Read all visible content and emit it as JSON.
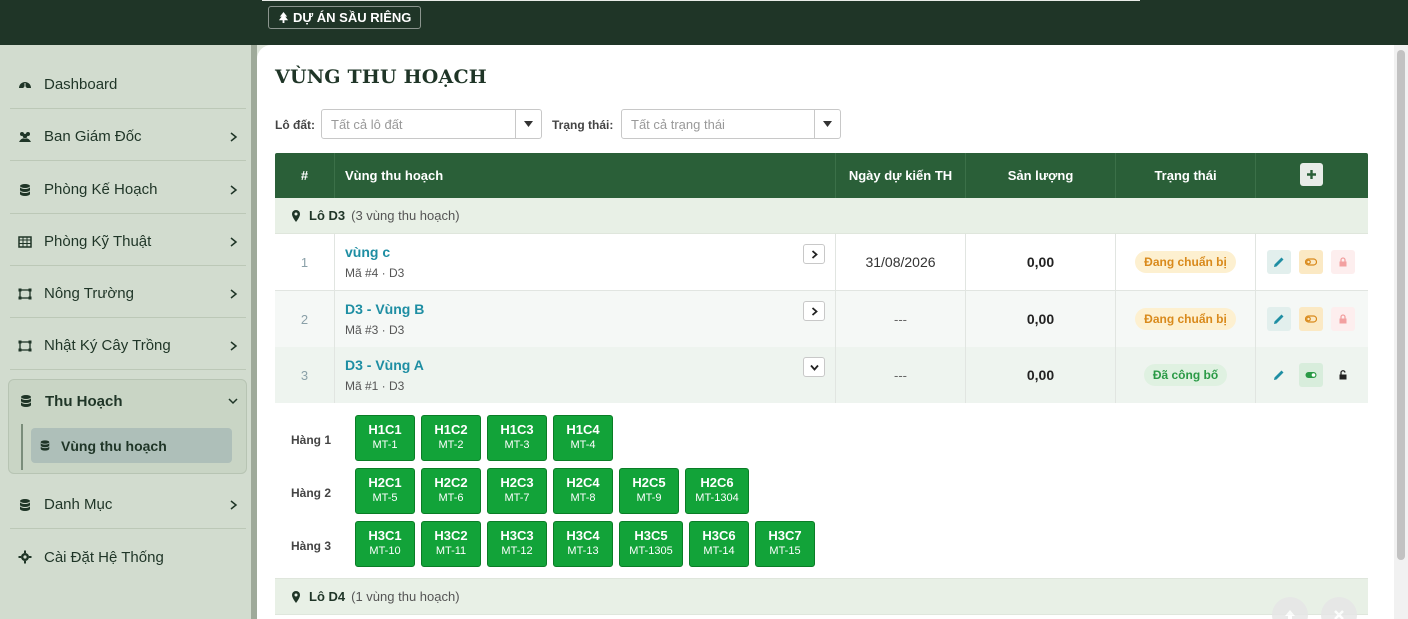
{
  "header": {
    "project_label": "DỰ ÁN SẦU RIÊNG"
  },
  "sidebar": {
    "items": [
      {
        "label": "Dashboard",
        "icon": "dashboard-icon"
      },
      {
        "label": "Ban Giám Đốc",
        "icon": "users-icon"
      },
      {
        "label": "Phòng Kế Hoạch",
        "icon": "database-icon"
      },
      {
        "label": "Phòng Kỹ Thuật",
        "icon": "table-icon"
      },
      {
        "label": "Nông Trường",
        "icon": "farm-icon"
      },
      {
        "label": "Nhật Ký Cây Trồng",
        "icon": "farm-icon"
      }
    ],
    "active_group": {
      "label": "Thu Hoạch",
      "sub_item": "Vùng thu hoạch"
    },
    "bottom_items": [
      {
        "label": "Danh Mục",
        "icon": "database-icon"
      },
      {
        "label": "Cài Đặt Hệ Thống",
        "icon": "gear-icon"
      }
    ]
  },
  "page": {
    "title": "VÙNG THU HOẠCH"
  },
  "filters": {
    "lot_label": "Lô đất:",
    "lot_placeholder": "Tất cả lô đất",
    "status_label": "Trạng thái:",
    "status_placeholder": "Tất cả trạng thái"
  },
  "table": {
    "headers": {
      "num": "#",
      "zone": "Vùng thu hoạch",
      "date": "Ngày dự kiến TH",
      "qty": "Sản lượng",
      "status": "Trạng thái"
    },
    "group1": {
      "name": "Lô D3",
      "count": "(3 vùng thu hoạch)"
    },
    "rows": [
      {
        "num": "1",
        "name": "vùng c",
        "sub": "Mã #4 · D3",
        "date": "31/08/2026",
        "qty": "0,00",
        "status": "Đang chuẩn bị"
      },
      {
        "num": "2",
        "name": "D3 - Vùng B",
        "sub": "Mã #3 · D3",
        "date": "---",
        "qty": "0,00",
        "status": "Đang chuẩn bị"
      },
      {
        "num": "3",
        "name": "D3 - Vùng A",
        "sub": "Mã #1 · D3",
        "date": "---",
        "qty": "0,00",
        "status": "Đã công bố"
      }
    ],
    "hang_labels": [
      "Hàng 1",
      "Hàng 2",
      "Hàng 3"
    ],
    "trees": [
      [
        {
          "code": "H1C1",
          "mt": "MT-1"
        },
        {
          "code": "H1C2",
          "mt": "MT-2"
        },
        {
          "code": "H1C3",
          "mt": "MT-3"
        },
        {
          "code": "H1C4",
          "mt": "MT-4"
        }
      ],
      [
        {
          "code": "H2C1",
          "mt": "MT-5"
        },
        {
          "code": "H2C2",
          "mt": "MT-6"
        },
        {
          "code": "H2C3",
          "mt": "MT-7"
        },
        {
          "code": "H2C4",
          "mt": "MT-8"
        },
        {
          "code": "H2C5",
          "mt": "MT-9"
        },
        {
          "code": "H2C6",
          "mt": "MT-1304"
        }
      ],
      [
        {
          "code": "H3C1",
          "mt": "MT-10"
        },
        {
          "code": "H3C2",
          "mt": "MT-11"
        },
        {
          "code": "H3C3",
          "mt": "MT-12"
        },
        {
          "code": "H3C4",
          "mt": "MT-13"
        },
        {
          "code": "H3C5",
          "mt": "MT-1305"
        },
        {
          "code": "H3C6",
          "mt": "MT-14"
        },
        {
          "code": "H3C7",
          "mt": "MT-15"
        }
      ]
    ],
    "group2": {
      "name": "Lô D4",
      "count": "(1 vùng thu hoạch)"
    }
  },
  "colors": {
    "primary": "#1f3527",
    "header": "#2a5f38",
    "tree": "#12a339",
    "link": "#1e8ea3",
    "prep": "#d98a1c",
    "published": "#2a9a46"
  }
}
